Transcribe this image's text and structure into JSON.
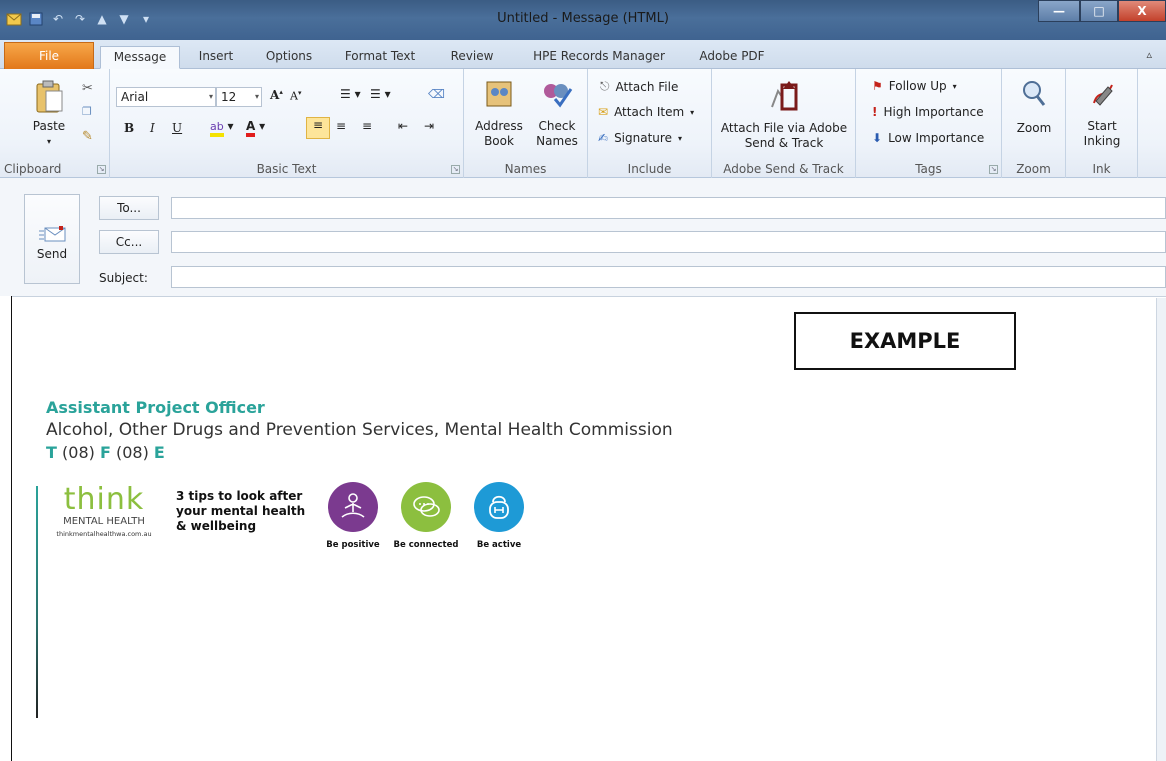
{
  "window": {
    "title": "Untitled - Message (HTML)",
    "buttons": {
      "minimize": "—",
      "maximize": "□",
      "close": "X"
    }
  },
  "tabs": [
    {
      "label": "File"
    },
    {
      "label": "Message"
    },
    {
      "label": "Insert"
    },
    {
      "label": "Options"
    },
    {
      "label": "Format Text"
    },
    {
      "label": "Review"
    },
    {
      "label": "HPE Records Manager"
    },
    {
      "label": "Adobe PDF"
    }
  ],
  "ribbon": {
    "clipboard": {
      "label": "Clipboard",
      "paste": "Paste"
    },
    "basic_text": {
      "label": "Basic Text",
      "font": "Arial",
      "size": "12"
    },
    "names": {
      "label": "Names",
      "address_book": "Address Book",
      "check_names": "Check Names"
    },
    "include": {
      "label": "Include",
      "attach_file": "Attach File",
      "attach_item": "Attach Item",
      "signature": "Signature"
    },
    "adobe": {
      "label": "Adobe Send & Track",
      "attach_via": "Attach File via Adobe Send & Track"
    },
    "tags": {
      "label": "Tags",
      "follow_up": "Follow Up",
      "high": "High Importance",
      "low": "Low Importance"
    },
    "zoom": {
      "label": "Zoom",
      "zoom": "Zoom"
    },
    "ink": {
      "label": "Ink",
      "start_inking": "Start Inking"
    }
  },
  "header": {
    "send": "Send",
    "to": "To...",
    "cc": "Cc...",
    "subject": "Subject:"
  },
  "body": {
    "example": "EXAMPLE",
    "sig_title": "Assistant Project Officer",
    "sig_dept": "Alcohol, Other Drugs and Prevention Services, Mental Health Commission",
    "phone_t": "T",
    "phone_t_val": "(08)",
    "phone_f": "F",
    "phone_f_val": "(08)",
    "phone_e": "E",
    "logo_think": "think",
    "logo_mh": "MENTAL HEALTH",
    "logo_url": "thinkmentalhealthwa.com.au",
    "tips": [
      "3 tips to look after",
      "your mental health",
      "& wellbeing"
    ],
    "tips_items": [
      {
        "label": "Be positive",
        "color": "#7b3a8f"
      },
      {
        "label": "Be connected",
        "color": "#8cbf3f"
      },
      {
        "label": "Be active",
        "color": "#1e9ad6"
      }
    ]
  }
}
